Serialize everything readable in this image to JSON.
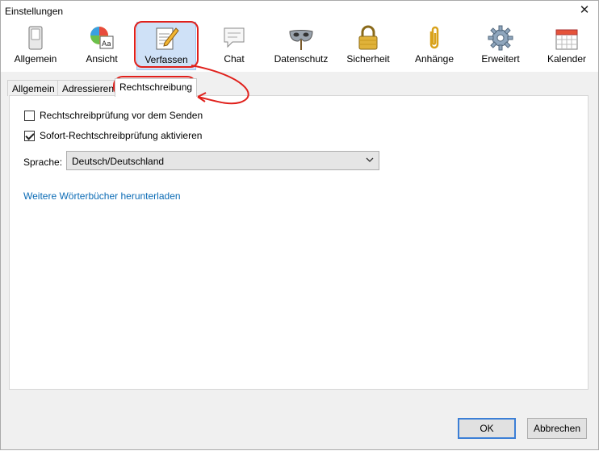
{
  "window": {
    "title": "Einstellungen"
  },
  "toolbar": {
    "items": [
      {
        "label": "Allgemein",
        "icon": "switch-icon"
      },
      {
        "label": "Ansicht",
        "icon": "palette-icon"
      },
      {
        "label": "Verfassen",
        "icon": "notepad-pencil-icon",
        "selected": true
      },
      {
        "label": "Chat",
        "icon": "speech-bubble-icon"
      },
      {
        "label": "Datenschutz",
        "icon": "mask-icon"
      },
      {
        "label": "Sicherheit",
        "icon": "padlock-icon"
      },
      {
        "label": "Anhänge",
        "icon": "paperclip-icon"
      },
      {
        "label": "Erweitert",
        "icon": "gear-icon"
      },
      {
        "label": "Kalender",
        "icon": "calendar-icon"
      }
    ]
  },
  "tabs": [
    {
      "label": "Allgemein"
    },
    {
      "label": "Adressieren"
    },
    {
      "label": "Rechtschreibung",
      "active": true
    }
  ],
  "spelling": {
    "check_before_send": {
      "label": "Rechtschreibprüfung vor dem Senden",
      "checked": false
    },
    "check_while_typing": {
      "label": "Sofort-Rechtschreibprüfung aktivieren",
      "checked": true
    },
    "language_label": "Sprache:",
    "language_value": "Deutsch/Deutschland",
    "download_link": "Weitere Wörterbücher herunterladen"
  },
  "buttons": {
    "ok": "OK",
    "cancel": "Abbrechen"
  },
  "colors": {
    "highlight": "#e0201b",
    "link": "#0b6bb5",
    "selected_bg": "#cfe1f7",
    "default_border": "#3c7fd6"
  }
}
